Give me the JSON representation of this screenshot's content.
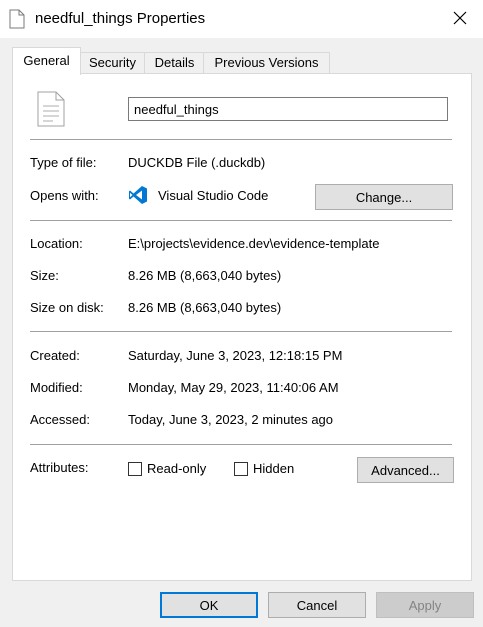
{
  "window": {
    "title": "needful_things Properties",
    "title_icon": "document-icon",
    "close_icon": "close-icon"
  },
  "tabs": [
    {
      "label": "General",
      "active": true
    },
    {
      "label": "Security",
      "active": false
    },
    {
      "label": "Details",
      "active": false
    },
    {
      "label": "Previous Versions",
      "active": false
    }
  ],
  "general": {
    "file_name": "needful_things",
    "file_icon": "document-icon",
    "type_label": "Type of file:",
    "type_value": "DUCKDB File (.duckdb)",
    "opens_label": "Opens with:",
    "opens_app": "Visual Studio Code",
    "opens_app_icon": "vscode-icon",
    "opens_app_color": "#0078d4",
    "change_button": "Change...",
    "location_label": "Location:",
    "location_value": "E:\\projects\\evidence.dev\\evidence-template",
    "size_label": "Size:",
    "size_value": "8.26 MB (8,663,040 bytes)",
    "size_disk_label": "Size on disk:",
    "size_disk_value": "8.26 MB (8,663,040 bytes)",
    "created_label": "Created:",
    "created_value": "Saturday, June 3, 2023, 12:18:15 PM",
    "modified_label": "Modified:",
    "modified_value": "Monday, May 29, 2023, 11:40:06 AM",
    "accessed_label": "Accessed:",
    "accessed_value": "Today, June 3, 2023, 2 minutes ago",
    "attributes_label": "Attributes:",
    "readonly_label": "Read-only",
    "readonly_checked": false,
    "hidden_label": "Hidden",
    "hidden_checked": false,
    "advanced_button": "Advanced..."
  },
  "footer": {
    "ok": "OK",
    "cancel": "Cancel",
    "apply": "Apply"
  },
  "colors": {
    "accent": "#0078d7",
    "disabled_text": "#838383"
  }
}
